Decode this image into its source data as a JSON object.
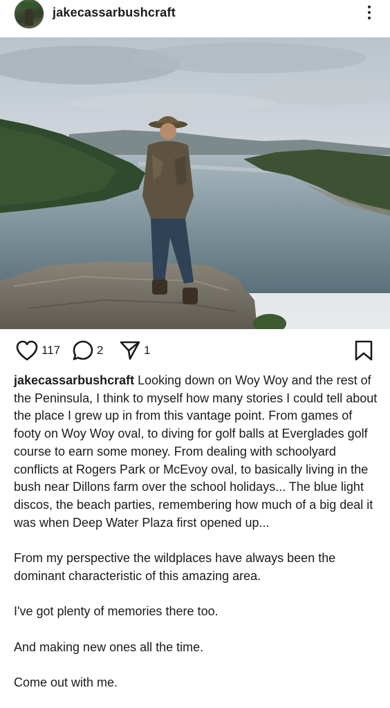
{
  "post": {
    "username": "jakecassarbushcraft",
    "likes": "117",
    "comments": "2",
    "shares": "1"
  },
  "caption": {
    "username": "jakecassarbushcraft",
    "p1": "Looking down on Woy Woy and the rest of the Peninsula, I think to myself how many stories I could tell about the place I grew up in from this vantage point. From games of footy on Woy Woy oval, to diving for golf balls at Everglades golf course to earn some money. From dealing with schoolyard conflicts at Rogers Park or McEvoy oval, to basically living in the bush near Dillons farm over the school holidays... The blue light discos, the beach parties, remembering how much of a big deal it was when Deep Water Plaza first opened up...",
    "p2": "From my perspective the wildplaces have always been the dominant characteristic of this amazing area.",
    "p3": "I've got plenty of memories there too.",
    "p4": "And making new ones all the time.",
    "p5": "Come out with me."
  },
  "icons": {
    "avatar": "profile-avatar",
    "more": "more-options-icon",
    "like": "heart-icon",
    "comment": "comment-icon",
    "share": "send-icon",
    "save": "bookmark-icon"
  }
}
